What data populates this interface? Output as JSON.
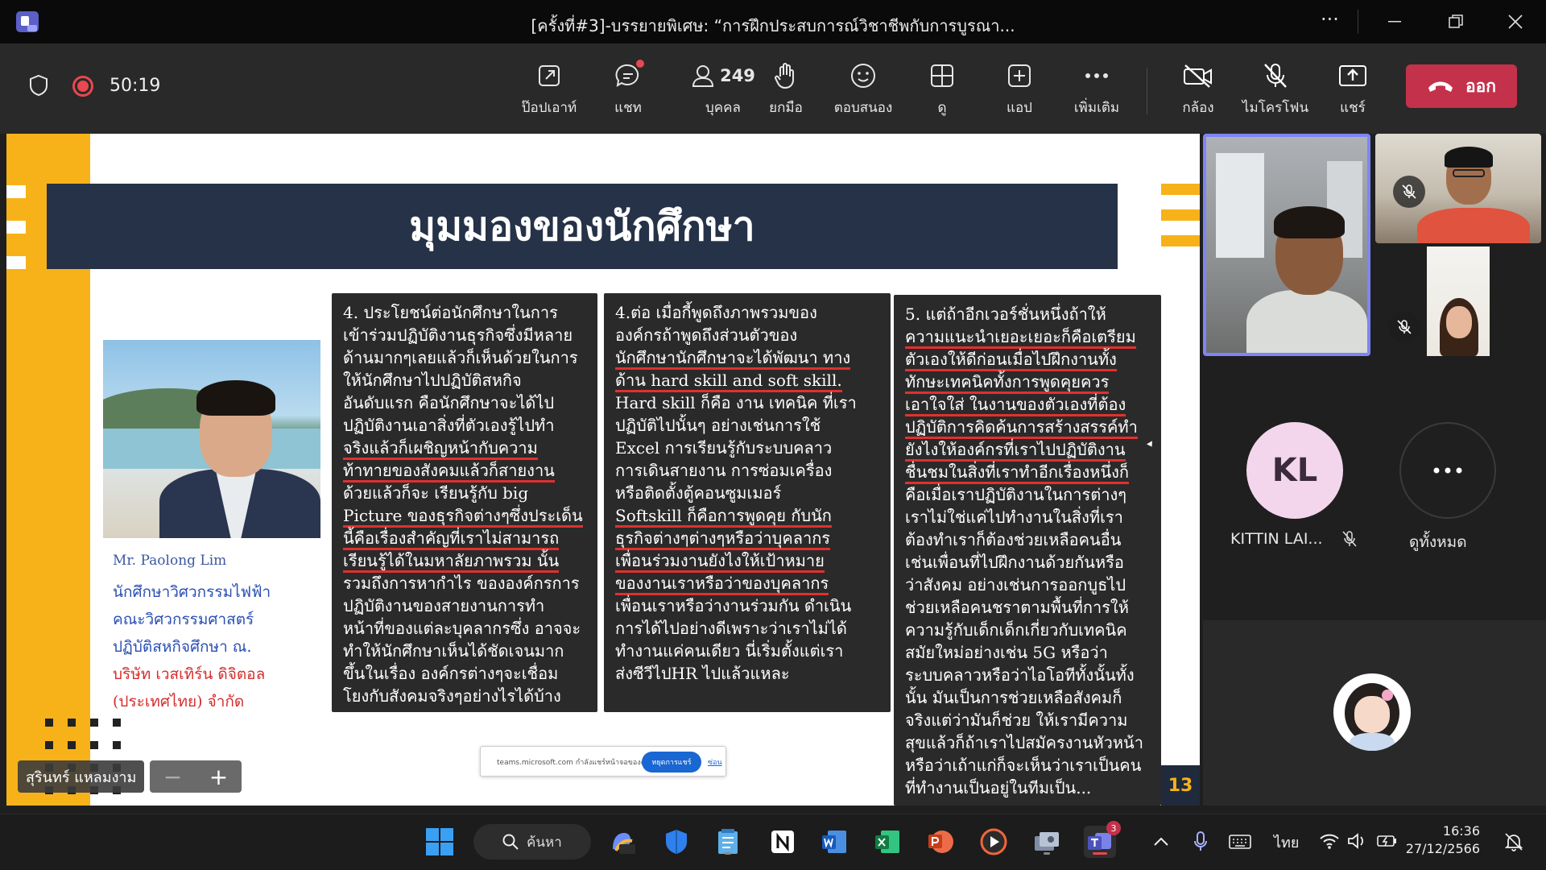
{
  "window": {
    "title": "[ครั้งที่#3]-บรรยายพิเศษ: “การฝึกประสบการณ์วิชาชีพกับการบูรณา...",
    "more_label": "···"
  },
  "toolbar": {
    "timer": "50:19",
    "buttons": [
      {
        "label": "ป๊อปเอาท์"
      },
      {
        "label": "แชท"
      },
      {
        "label": "บุคคล",
        "count": "249"
      },
      {
        "label": "ยกมือ"
      },
      {
        "label": "ตอบสนอง"
      },
      {
        "label": "ดู"
      },
      {
        "label": "แอป"
      },
      {
        "label": "เพิ่มเติม"
      },
      {
        "label": "กล้อง"
      },
      {
        "label": "ไมโครโฟน"
      },
      {
        "label": "แชร์"
      }
    ],
    "leave_label": "ออก",
    "colors": {
      "leave": "#c4314b",
      "record": "#e8484f",
      "speaker_border": "#7f85f5"
    }
  },
  "slide": {
    "title": "มุมมองของนักศึกษา",
    "caption": {
      "name": "Mr. Paolong Lim",
      "lines": [
        "นักศึกษาวิศวกรรมไฟฟ้า",
        "คณะวิศวกรรมศาสตร์",
        "ปฏิบัติสหกิจศึกษา ณ.",
        "บริษัท เวสเทิร์น ดิจิตอล",
        "(ประเทศไทย) จำกัด"
      ]
    },
    "panel1": [
      "4. ประโยชน์ต่อนักศึกษาในการ",
      "เข้าร่วมปฏิบัติงานธุรกิจซึ่งมีหลาย",
      "ด้านมากๆเลยแล้วก็เห็นด้วยในการ",
      "ให้นักศึกษาไปปฏิบัติสหกิจ",
      "อันดับแรก คือนักศึกษาจะได้ไป",
      "ปฏิบัติงานเอาสิ่งที่ตัวเองรู้ไปทำ",
      "จริงแล้วก็เผชิญหน้ากับความ",
      "ท้าทายของสังคมแล้วก็สายงาน",
      "ด้วยแล้วก็จะ เรียนรู้กับ big",
      "Picture ของธุรกิจต่างๆซึ่งประเด็น",
      "นี้คือเรื่องสำคัญที่เราไม่สามารถ",
      "เรียนรู้ได้ในมหาลัยภาพรวม นั้น",
      "รวมถึงการหากำไร ขององค์กรการ",
      "ปฏิบัติงานของสายงานการทำ",
      "หน้าที่ของแต่ละบุคลากรซึ่ง อาจจะ",
      "ทำให้นักศึกษาเห็นได้ชัดเจนมาก",
      "ขึ้นในเรื่อง องค์กรต่างๆจะเชื่อม",
      "โยงกับสังคมจริงๆอย่างไรได้บ้าง"
    ],
    "panel2": [
      "4.ต่อ เมื่อกี้พูดถึงภาพรวมของ",
      "องค์กรถ้าพูดถึงส่วนตัวของ",
      "นักศึกษานักศึกษาจะได้พัฒนา ทาง",
      "ด้าน hard skill and soft skill.",
      "Hard skill ก็คือ งาน เทคนิค ที่เรา",
      "ปฏิบัติไปนั้นๆ อย่างเช่นการใช้",
      "Excel การเรียนรู้กับระบบคลาว",
      "การเดินสายงาน การซ่อมเครื่อง",
      "หรือติดตั้งตู้คอนซูมเมอร์",
      "Softskill ก็คือการพูดคุย กับนัก",
      "ธุรกิจต่างๆต่างๆหรือว่าบุคลากร",
      "เพื่อนร่วมงานยังไงให้เป้าหมาย",
      "ของงานเราหรือว่าของบุคลากร",
      "เพื่อนเราหรือว่างานร่วมกัน ดำเนิน",
      "การได้ไปอย่างดีเพราะว่าเราไม่ได้",
      "ทำงานแค่คนเดียว นี่เริ่มตั้งแต่เรา",
      "ส่งซีวีไปHR ไปแล้วแหละ"
    ],
    "panel3": [
      "5. แต่ถ้าอีกเวอร์ชั่นหนึ่งถ้าให้",
      "ความแนะนำเยอะเยอะก็คือเตรียม",
      "ตัวเองให้ดีก่อนเมื่อไปฝึกงานทั้ง",
      "ทักษะเทคนิคทั้งการพูดคุยควร",
      "เอาใจใส่ ในงานของตัวเองที่ต้อง",
      "ปฏิบัติการคิดค้นการสร้างสรรค์ทำ",
      "ยังไงให้องค์กรที่เราไปปฏิบัติงาน",
      "ชื่นชมในสิ่งที่เราทำอีกเรื่องหนึ่งก็",
      "คือเมื่อเราปฏิบัติงานในการต่างๆ",
      "เราไม่ใช่แค่ไปทำงานในสิ่งที่เรา",
      "ต้องทำเราก็ต้องช่วยเหลือคนอื่น",
      "เช่นเพื่อนที่ไปฝึกงานด้วยกันหรือ",
      "ว่าสังคม อย่างเช่นการออกบูธไป",
      "ช่วยเหลือคนชราตามพื้นที่การให้",
      "ความรู้กับเด็กเด็กเกี่ยวกับเทคนิค",
      "สมัยใหม่อย่างเช่น 5G หรือว่า",
      "ระบบคลาวหรือว่าไอโอทีทั้งนั้นทั้ง",
      "นั้น มันเป็นการช่วยเหลือสังคมก็",
      "จริงแต่ว่ามันก็ช่วย ให้เรามีความ",
      "สุขแล้วก็ถ้าเราไปสมัครงานหัวหน้า",
      "หรือว่าเถ้าแก่ก็จะเห็นว่าเราเป็นคน",
      "ที่ทำงานเป็นอยู่ในทีมเป็น..."
    ],
    "notification": {
      "text": "teams.microsoft.com กำลังแชร์หน้าจอของคุณ",
      "button": "หยุดการแชร์",
      "link": "ซ่อน"
    },
    "page_number": "13"
  },
  "presenter_chip": "สุรินทร์ แหลมงาม",
  "participants": {
    "kl": {
      "initials": "KL",
      "name": "KITTIN LAI..."
    },
    "more_label": "ดูทั้งหมด"
  },
  "taskbar": {
    "search_label": "ค้นหา",
    "teams_badge": "3",
    "language": "ไทย",
    "time": "16:36",
    "date": "27/12/2566"
  }
}
